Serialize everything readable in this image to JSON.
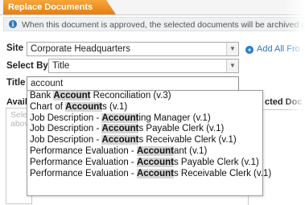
{
  "window": {
    "title": "Replace Documents"
  },
  "info": {
    "text": "When this document is approved, the selected documents will be archived and re"
  },
  "site": {
    "label": "Site",
    "value": "Corporate Headquarters"
  },
  "select_by": {
    "label": "Select By",
    "value": "Title"
  },
  "add_all": {
    "label": "Add All Fro"
  },
  "title_field": {
    "label": "Title",
    "value": "account"
  },
  "available": {
    "label": "Avail",
    "placeholder_line1": "Sele",
    "placeholder_line2": "abov"
  },
  "selected": {
    "label": "cted Doc"
  },
  "suggestions": [
    {
      "before": "Bank ",
      "match": "Account",
      "after": " Reconciliation (v.3)"
    },
    {
      "before": "Chart of ",
      "match": "Account",
      "after": "s (v.1)"
    },
    {
      "before": "Job Description - ",
      "match": "Account",
      "after": "ing Manager (v.1)"
    },
    {
      "before": "Job Description - ",
      "match": "Account",
      "after": "s Payable Clerk (v.1)"
    },
    {
      "before": "Job Description - ",
      "match": "Account",
      "after": "s Receivable Clerk (v.1)"
    },
    {
      "before": "Performance Evaluation - ",
      "match": "Account",
      "after": "ant (v.1)"
    },
    {
      "before": "Performance Evaluation - ",
      "match": "Account",
      "after": "s Payable Clerk (v.1)"
    },
    {
      "before": "Performance Evaluation - ",
      "match": "Account",
      "after": "s Receivable Clerk (v.1)"
    }
  ],
  "icons": {
    "info": "info-icon",
    "add": "plus-circle-icon",
    "dropdown": "chevron-down-icon"
  },
  "colors": {
    "accent": "#e8861a",
    "link": "#2a78c2"
  }
}
